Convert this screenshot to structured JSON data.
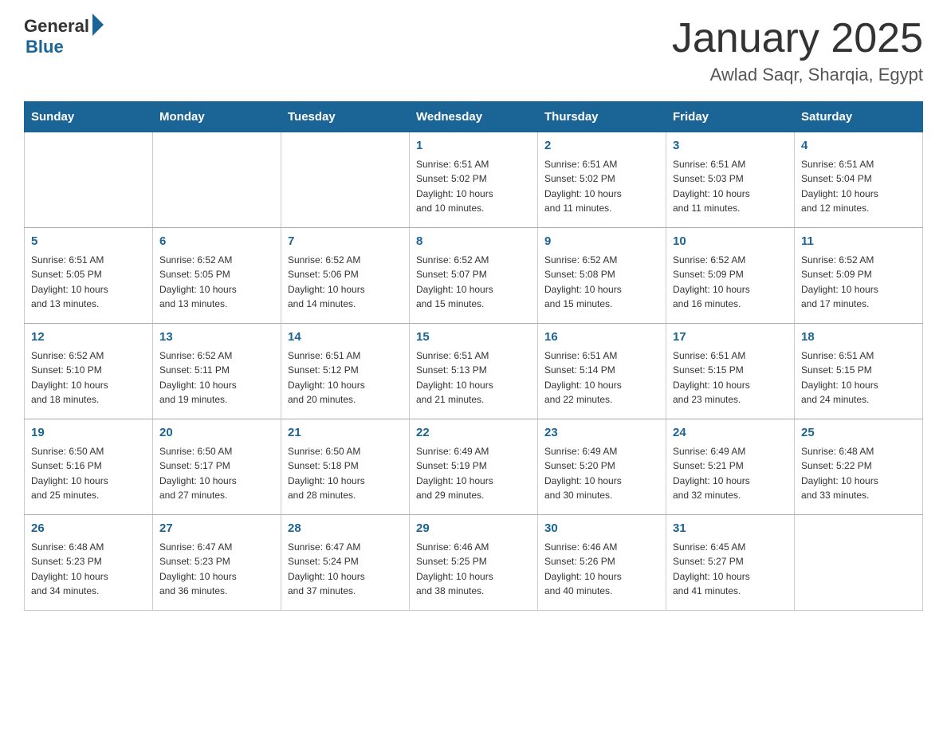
{
  "header": {
    "logo_general": "General",
    "logo_blue": "Blue",
    "month_title": "January 2025",
    "location": "Awlad Saqr, Sharqia, Egypt"
  },
  "weekdays": [
    "Sunday",
    "Monday",
    "Tuesday",
    "Wednesday",
    "Thursday",
    "Friday",
    "Saturday"
  ],
  "weeks": [
    [
      {
        "day": "",
        "info": ""
      },
      {
        "day": "",
        "info": ""
      },
      {
        "day": "",
        "info": ""
      },
      {
        "day": "1",
        "info": "Sunrise: 6:51 AM\nSunset: 5:02 PM\nDaylight: 10 hours\nand 10 minutes."
      },
      {
        "day": "2",
        "info": "Sunrise: 6:51 AM\nSunset: 5:02 PM\nDaylight: 10 hours\nand 11 minutes."
      },
      {
        "day": "3",
        "info": "Sunrise: 6:51 AM\nSunset: 5:03 PM\nDaylight: 10 hours\nand 11 minutes."
      },
      {
        "day": "4",
        "info": "Sunrise: 6:51 AM\nSunset: 5:04 PM\nDaylight: 10 hours\nand 12 minutes."
      }
    ],
    [
      {
        "day": "5",
        "info": "Sunrise: 6:51 AM\nSunset: 5:05 PM\nDaylight: 10 hours\nand 13 minutes."
      },
      {
        "day": "6",
        "info": "Sunrise: 6:52 AM\nSunset: 5:05 PM\nDaylight: 10 hours\nand 13 minutes."
      },
      {
        "day": "7",
        "info": "Sunrise: 6:52 AM\nSunset: 5:06 PM\nDaylight: 10 hours\nand 14 minutes."
      },
      {
        "day": "8",
        "info": "Sunrise: 6:52 AM\nSunset: 5:07 PM\nDaylight: 10 hours\nand 15 minutes."
      },
      {
        "day": "9",
        "info": "Sunrise: 6:52 AM\nSunset: 5:08 PM\nDaylight: 10 hours\nand 15 minutes."
      },
      {
        "day": "10",
        "info": "Sunrise: 6:52 AM\nSunset: 5:09 PM\nDaylight: 10 hours\nand 16 minutes."
      },
      {
        "day": "11",
        "info": "Sunrise: 6:52 AM\nSunset: 5:09 PM\nDaylight: 10 hours\nand 17 minutes."
      }
    ],
    [
      {
        "day": "12",
        "info": "Sunrise: 6:52 AM\nSunset: 5:10 PM\nDaylight: 10 hours\nand 18 minutes."
      },
      {
        "day": "13",
        "info": "Sunrise: 6:52 AM\nSunset: 5:11 PM\nDaylight: 10 hours\nand 19 minutes."
      },
      {
        "day": "14",
        "info": "Sunrise: 6:51 AM\nSunset: 5:12 PM\nDaylight: 10 hours\nand 20 minutes."
      },
      {
        "day": "15",
        "info": "Sunrise: 6:51 AM\nSunset: 5:13 PM\nDaylight: 10 hours\nand 21 minutes."
      },
      {
        "day": "16",
        "info": "Sunrise: 6:51 AM\nSunset: 5:14 PM\nDaylight: 10 hours\nand 22 minutes."
      },
      {
        "day": "17",
        "info": "Sunrise: 6:51 AM\nSunset: 5:15 PM\nDaylight: 10 hours\nand 23 minutes."
      },
      {
        "day": "18",
        "info": "Sunrise: 6:51 AM\nSunset: 5:15 PM\nDaylight: 10 hours\nand 24 minutes."
      }
    ],
    [
      {
        "day": "19",
        "info": "Sunrise: 6:50 AM\nSunset: 5:16 PM\nDaylight: 10 hours\nand 25 minutes."
      },
      {
        "day": "20",
        "info": "Sunrise: 6:50 AM\nSunset: 5:17 PM\nDaylight: 10 hours\nand 27 minutes."
      },
      {
        "day": "21",
        "info": "Sunrise: 6:50 AM\nSunset: 5:18 PM\nDaylight: 10 hours\nand 28 minutes."
      },
      {
        "day": "22",
        "info": "Sunrise: 6:49 AM\nSunset: 5:19 PM\nDaylight: 10 hours\nand 29 minutes."
      },
      {
        "day": "23",
        "info": "Sunrise: 6:49 AM\nSunset: 5:20 PM\nDaylight: 10 hours\nand 30 minutes."
      },
      {
        "day": "24",
        "info": "Sunrise: 6:49 AM\nSunset: 5:21 PM\nDaylight: 10 hours\nand 32 minutes."
      },
      {
        "day": "25",
        "info": "Sunrise: 6:48 AM\nSunset: 5:22 PM\nDaylight: 10 hours\nand 33 minutes."
      }
    ],
    [
      {
        "day": "26",
        "info": "Sunrise: 6:48 AM\nSunset: 5:23 PM\nDaylight: 10 hours\nand 34 minutes."
      },
      {
        "day": "27",
        "info": "Sunrise: 6:47 AM\nSunset: 5:23 PM\nDaylight: 10 hours\nand 36 minutes."
      },
      {
        "day": "28",
        "info": "Sunrise: 6:47 AM\nSunset: 5:24 PM\nDaylight: 10 hours\nand 37 minutes."
      },
      {
        "day": "29",
        "info": "Sunrise: 6:46 AM\nSunset: 5:25 PM\nDaylight: 10 hours\nand 38 minutes."
      },
      {
        "day": "30",
        "info": "Sunrise: 6:46 AM\nSunset: 5:26 PM\nDaylight: 10 hours\nand 40 minutes."
      },
      {
        "day": "31",
        "info": "Sunrise: 6:45 AM\nSunset: 5:27 PM\nDaylight: 10 hours\nand 41 minutes."
      },
      {
        "day": "",
        "info": ""
      }
    ]
  ]
}
